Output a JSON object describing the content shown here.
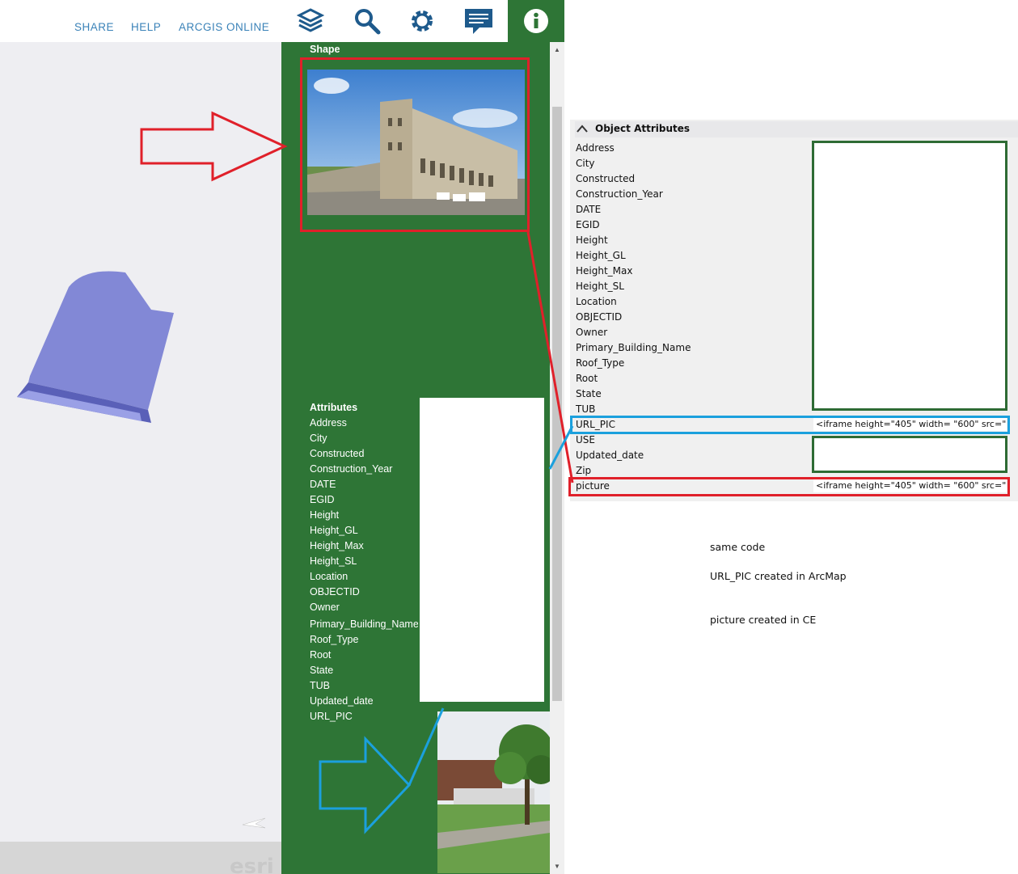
{
  "topbar": {
    "links": [
      "SHARE",
      "HELP",
      "ARCGIS ONLINE"
    ],
    "tools": [
      "layers-icon",
      "search-icon",
      "gear-icon",
      "comment-icon",
      "info-icon"
    ]
  },
  "panel": {
    "shape_label": "Shape",
    "attributes_label": "Attributes",
    "attributes": [
      "Address",
      "City",
      "Constructed",
      "Construction_Year",
      "DATE",
      "EGID",
      "Height",
      "Height_GL",
      "Height_Max",
      "Height_SL",
      "Location",
      "OBJECTID",
      "Owner",
      "Primary_Building_Name",
      "Roof_Type",
      "Root",
      "State",
      "TUB",
      "Updated_date",
      "URL_PIC"
    ]
  },
  "object_attributes": {
    "title": "Object Attributes",
    "rows": [
      "Address",
      "City",
      "Constructed",
      "Construction_Year",
      "DATE",
      "EGID",
      "Height",
      "Height_GL",
      "Height_Max",
      "Height_SL",
      "Location",
      "OBJECTID",
      "Owner",
      "Primary_Building_Name",
      "Roof_Type",
      "Root",
      "State",
      "TUB",
      "URL_PIC",
      "USE",
      "Updated_date",
      "Zip",
      "picture"
    ],
    "url_pic_value": "<iframe height=\"405\" width= \"600\" src=\"h...",
    "picture_value": "<iframe height=\"405\" width= \"600\" src=\"h..."
  },
  "notes": {
    "line1": "same code",
    "line2": "URL_PIC created in ArcMap",
    "line3": "picture created in CE"
  },
  "colors": {
    "panel_green": "#2e7536",
    "annotation_red": "#e0202a",
    "annotation_blue": "#1ba0dd",
    "annotation_green": "#2e6b34",
    "shape_fill": "#8288d6"
  }
}
